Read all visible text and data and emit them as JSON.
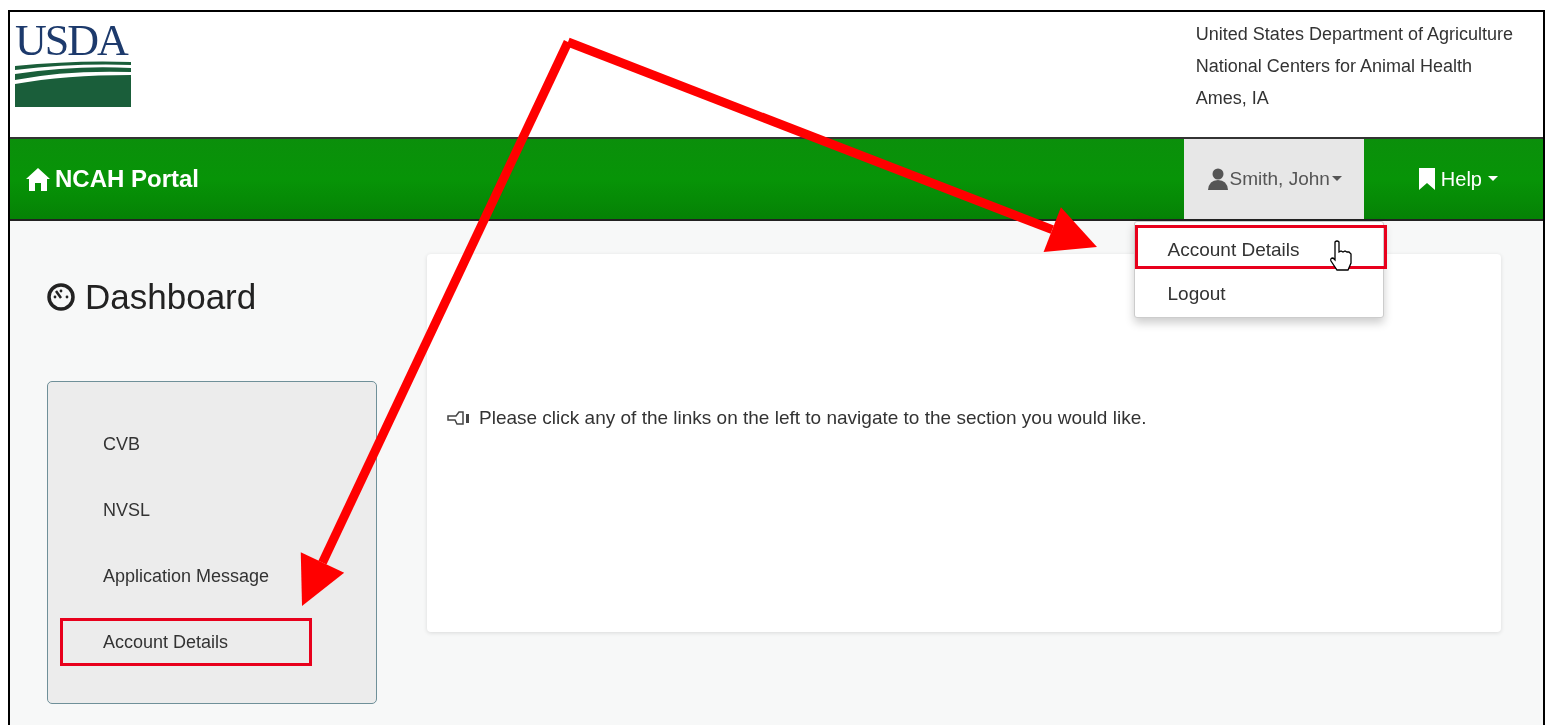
{
  "header": {
    "logo_text": "USDA",
    "agency_lines": [
      "United States Department of Agriculture",
      "National Centers for Animal Health",
      "Ames, IA"
    ]
  },
  "navbar": {
    "brand": "NCAH Portal",
    "user_menu": {
      "label": "Smith, John",
      "expanded": true,
      "items": [
        {
          "label": "Account Details",
          "highlighted": true
        },
        {
          "label": "Logout",
          "highlighted": false
        }
      ]
    },
    "help_menu": {
      "label": "Help"
    }
  },
  "dashboard": {
    "title": "Dashboard",
    "nav_items": [
      {
        "label": "CVB",
        "highlighted": false
      },
      {
        "label": "NVSL",
        "highlighted": false
      },
      {
        "label": "Application Message",
        "highlighted": false
      },
      {
        "label": "Account Details",
        "highlighted": true
      }
    ]
  },
  "message": "Please click any of the links on the left to navigate to the section you would like."
}
